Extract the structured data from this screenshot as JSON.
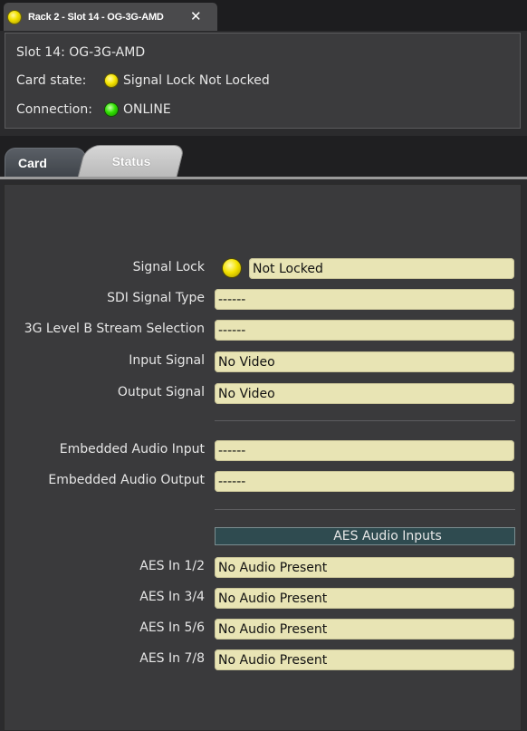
{
  "window": {
    "tab_title": "Rack 2 - Slot 14 - OG-3G-AMD",
    "close_glyph": "✕",
    "title_led_color": "#f3e200"
  },
  "info": {
    "slot": "Slot 14: OG-3G-AMD",
    "card_state_label": "Card state:",
    "card_state_value": "Signal Lock Not Locked",
    "card_state_led": "yellow",
    "connection_label": "Connection:",
    "connection_value": "ONLINE",
    "connection_led": "green"
  },
  "tabs": [
    {
      "label": "Card",
      "selected": false
    },
    {
      "label": "Status",
      "selected": true
    }
  ],
  "status": {
    "signal_lock": {
      "label": "Signal Lock",
      "value": "Not Locked",
      "led": "yellow"
    },
    "sdi_signal_type": {
      "label": "SDI Signal Type",
      "value": "------"
    },
    "stream_selection": {
      "label": "3G Level B Stream Selection",
      "value": "------"
    },
    "input_signal": {
      "label": "Input Signal",
      "value": "No Video"
    },
    "output_signal": {
      "label": "Output Signal",
      "value": "No Video"
    },
    "embedded_audio_input": {
      "label": "Embedded Audio Input",
      "value": "------"
    },
    "embedded_audio_output": {
      "label": "Embedded Audio Output",
      "value": "------"
    },
    "aes_header": "AES Audio Inputs",
    "aes": [
      {
        "label": "AES In 1/2",
        "value": "No Audio Present"
      },
      {
        "label": "AES In 3/4",
        "value": "No Audio Present"
      },
      {
        "label": "AES In 5/6",
        "value": "No Audio Present"
      },
      {
        "label": "AES In 7/8",
        "value": "No Audio Present"
      }
    ]
  },
  "colors": {
    "field_bg": "#e8e4b4",
    "panel_bg": "#3a3a3c",
    "aes_header_bg": "#2f4b50",
    "led_yellow": "#f5e300",
    "led_green": "#30e000"
  }
}
